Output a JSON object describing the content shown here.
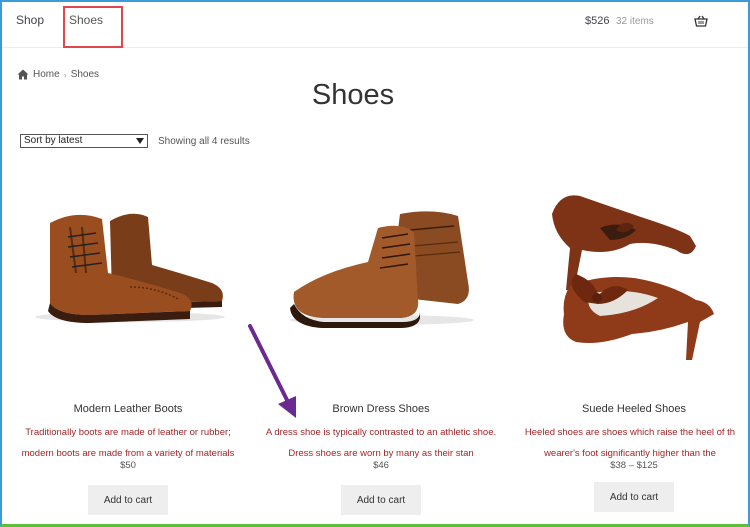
{
  "nav": {
    "shop_label": "Shop",
    "shoes_label": "Shoes"
  },
  "cart": {
    "total": "$526",
    "count": "32 items",
    "icon": "basket-icon"
  },
  "breadcrumb": {
    "home": "Home",
    "current": "Shoes"
  },
  "page": {
    "title": "Shoes"
  },
  "toolbar": {
    "sort_value": "Sort by latest",
    "result_count": "Showing all 4 results"
  },
  "products": [
    {
      "title": "Modern Leather Boots",
      "desc_line1": "Traditionally boots are made of leather or rubber;",
      "desc_line2": "modern boots are made from a variety of materials",
      "price": "$50",
      "button": "Add to cart"
    },
    {
      "title": "Brown Dress Shoes",
      "desc_line1": "A dress shoe is typically contrasted to an athletic shoe.",
      "desc_line2": "Dress shoes are worn by many as their stan",
      "price": "$46",
      "button": "Add to cart"
    },
    {
      "title": "Suede Heeled Shoes",
      "desc_line1": "Heeled shoes are shoes which raise the heel of th",
      "desc_line2": "wearer's foot significantly higher than the",
      "price": "$38 – $125",
      "button": "Add to cart"
    }
  ],
  "colors": {
    "highlight_box": "#e0474c",
    "annotation_arrow": "#6a2a91",
    "description_text": "#a2262a"
  }
}
